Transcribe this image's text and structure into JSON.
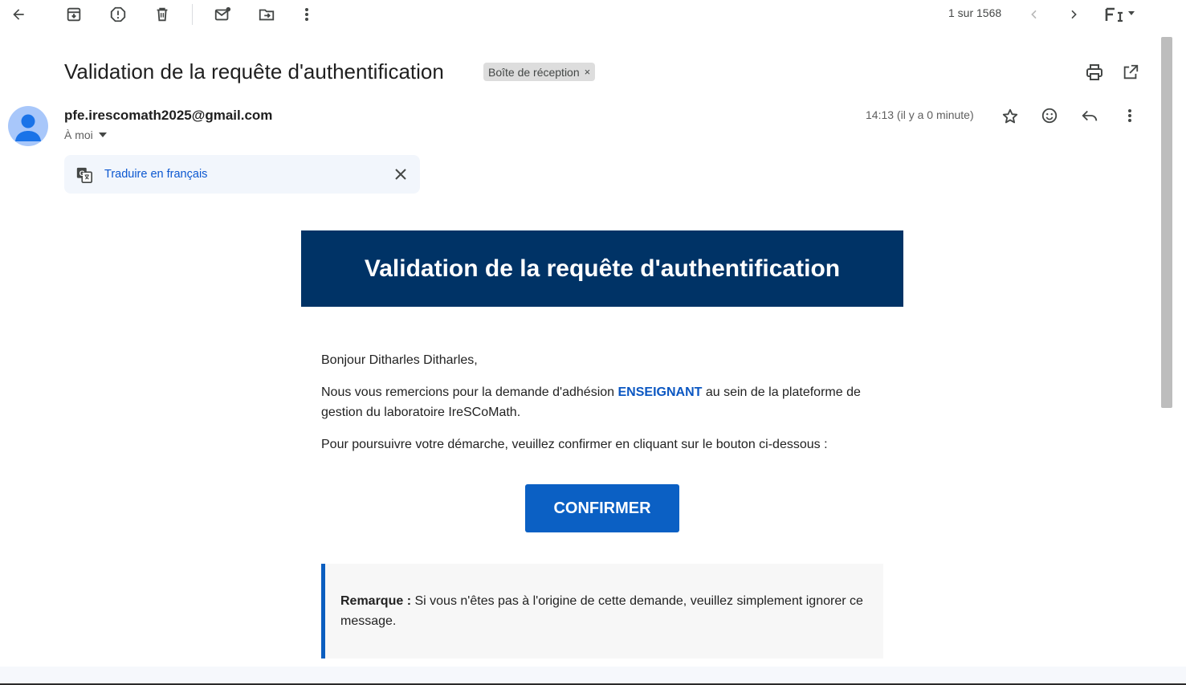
{
  "toolbar": {
    "back_icon": "arrow-left-icon",
    "archive_icon": "archive-icon",
    "spam_icon": "report-spam-icon",
    "delete_icon": "trash-icon",
    "mark_unread_icon": "mark-unread-icon",
    "move_icon": "move-to-icon",
    "more_icon": "more-vertical-icon",
    "pager_text": "1 sur 1568",
    "input_tools_icon": "input-tools-icon"
  },
  "message": {
    "subject": "Validation de la requête d'authentification",
    "label": "Boîte de réception",
    "label_remove": "×",
    "sender": "pfe.irescomath2025@gmail.com",
    "recipient": "À moi",
    "timestamp": "14:13 (il y a 0 minute)"
  },
  "translate": {
    "link_label": "Traduire en français"
  },
  "email": {
    "header_title": "Validation de la requête d'authentification",
    "greeting": "Bonjour Ditharles Ditharles,",
    "p1_before": "Nous vous remercions pour la demande d'adhésion ",
    "p1_highlight": "ENSEIGNANT",
    "p1_after": " au sein de la plateforme de gestion du laboratoire IreSCoMath.",
    "p2": "Pour poursuivre votre démarche, veuillez confirmer en cliquant sur le bouton ci-dessous :",
    "button_label": "CONFIRMER",
    "note_label": "Remarque :",
    "note_text": " Si vous n'êtes pas à l'origine de cette demande, veuillez simplement ignorer ce message."
  },
  "colors": {
    "header_bg": "#003366",
    "button_bg": "#0b60c4",
    "accent_blue": "#0b57d0",
    "note_border": "#0b5ec0"
  }
}
